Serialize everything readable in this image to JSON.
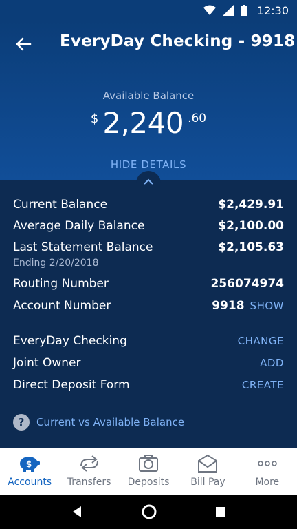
{
  "status_bar": {
    "time": "12:30"
  },
  "header": {
    "title": "EveryDay Checking - 9918",
    "available_label": "Available Balance",
    "currency_symbol": "$",
    "available_whole": "2,240",
    "available_cents": ".60",
    "hide_details": "HIDE DETAILS"
  },
  "details": {
    "current_balance_label": "Current Balance",
    "current_balance": "$2,429.91",
    "avg_daily_label": "Average Daily Balance",
    "avg_daily": "$2,100.00",
    "last_stmt_label": "Last Statement Balance",
    "last_stmt": "$2,105.63",
    "last_stmt_sub": "Ending 2/20/2018",
    "routing_label": "Routing Number",
    "routing": "256074974",
    "account_label": "Account Number",
    "account": "9918",
    "show": "SHOW",
    "product_label": "EveryDay Checking",
    "change": "CHANGE",
    "joint_label": "Joint Owner",
    "add": "ADD",
    "ddf_label": "Direct Deposit Form",
    "create": "CREATE",
    "help_text": "Current vs Available Balance"
  },
  "tabs": [
    {
      "label": "Accounts",
      "icon": "piggy-bank-icon"
    },
    {
      "label": "Transfers",
      "icon": "transfer-arrows-icon"
    },
    {
      "label": "Deposits",
      "icon": "camera-icon"
    },
    {
      "label": "Bill Pay",
      "icon": "envelope-icon"
    },
    {
      "label": "More",
      "icon": "more-dots-icon"
    }
  ],
  "colors": {
    "header": "#0b3d78",
    "details_bg": "#0d2b52",
    "link": "#7fb2f5",
    "active_tab": "#1565c0"
  }
}
